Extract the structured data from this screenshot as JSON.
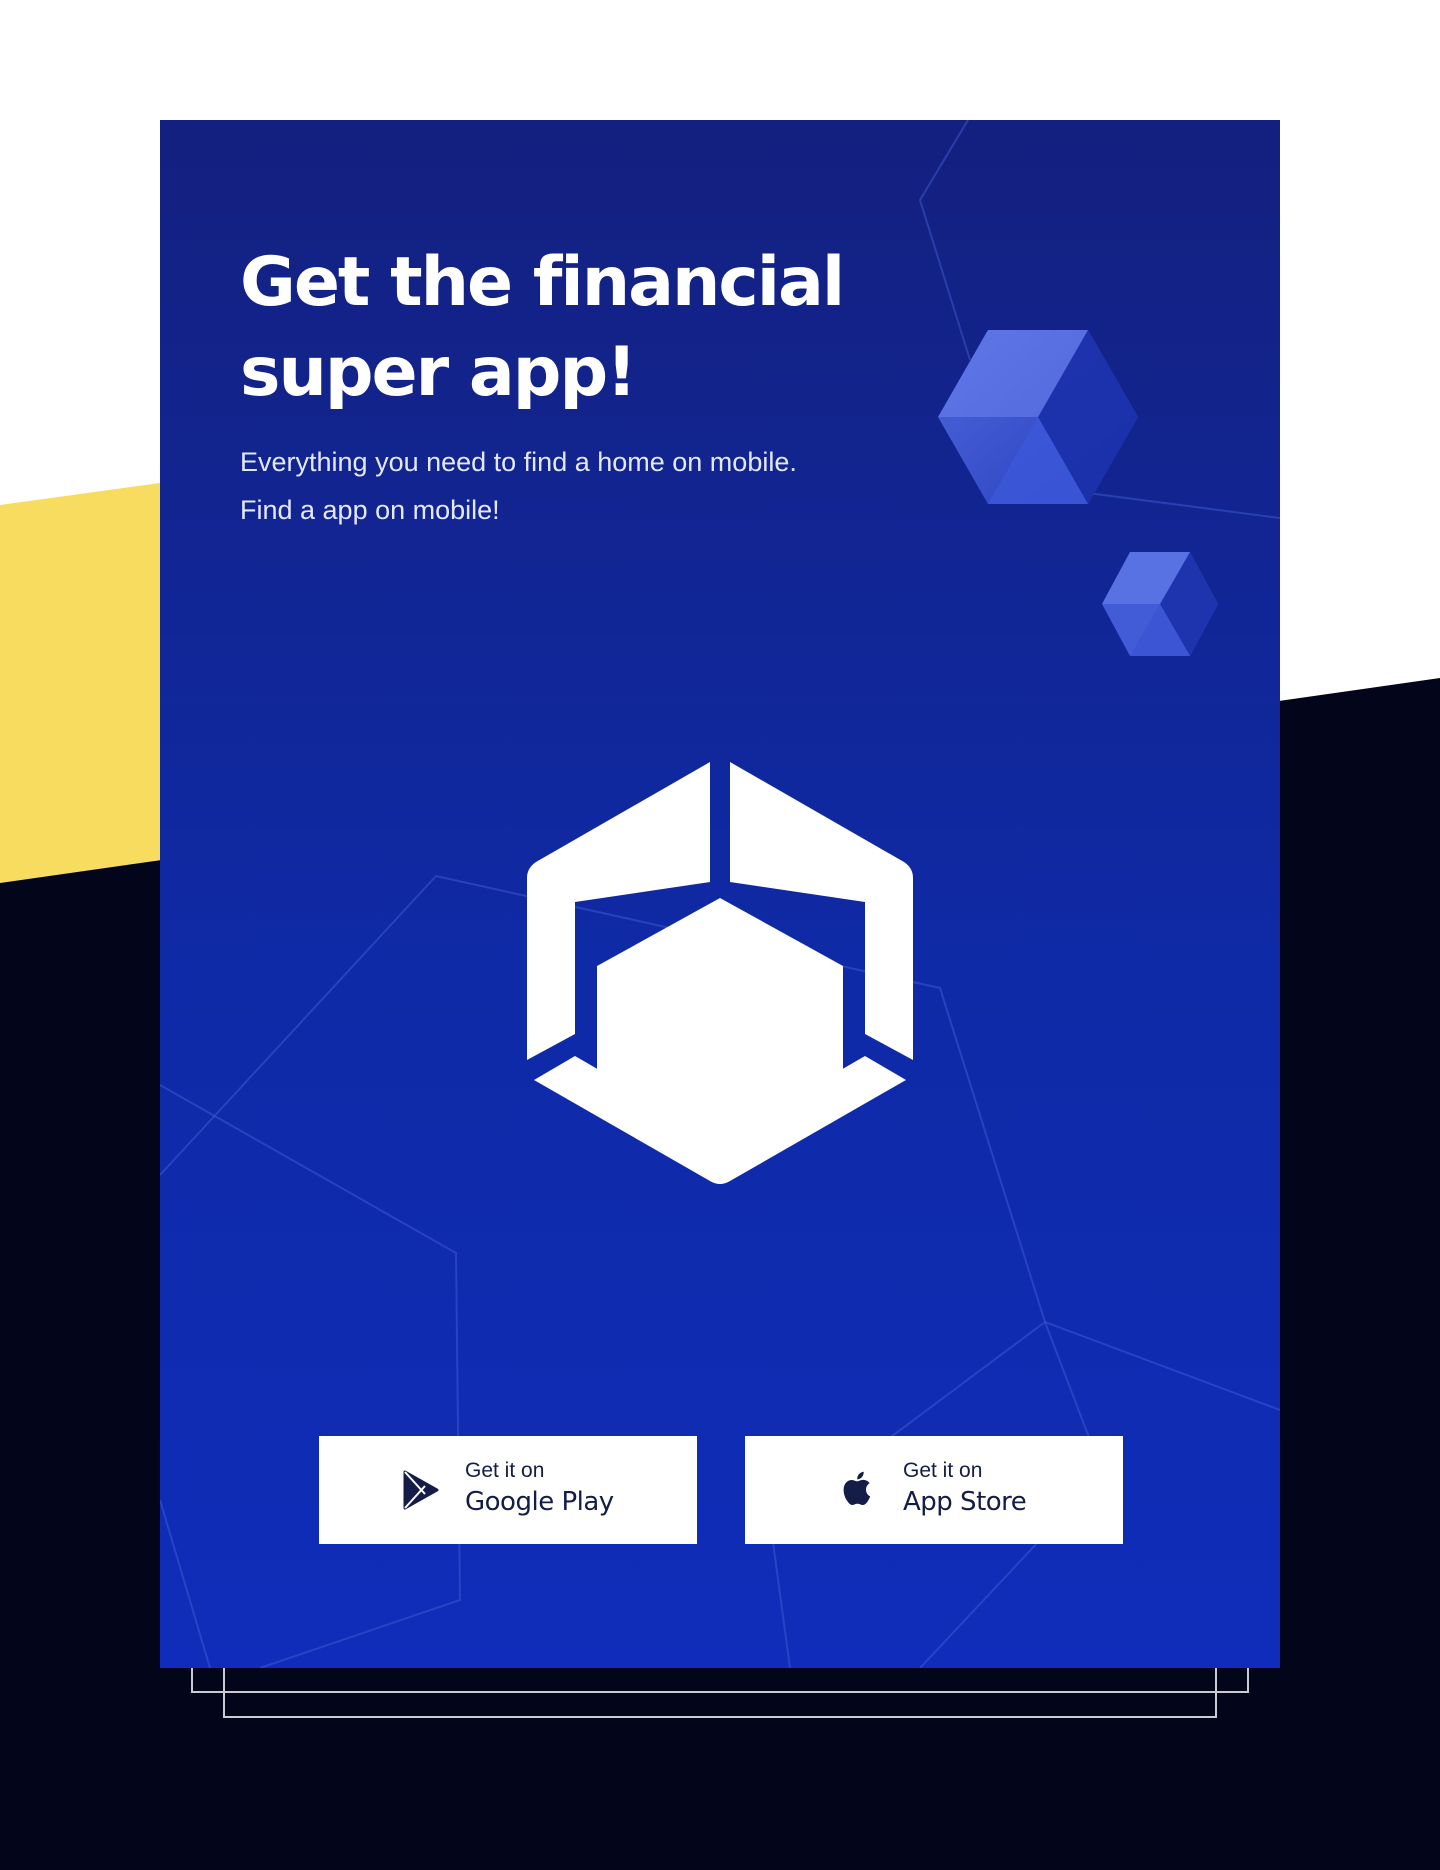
{
  "colors": {
    "card_top": "#14207f",
    "card_bottom": "#0f2dba",
    "accent_yellow": "#f7dc60",
    "dark_background": "#03061a",
    "text_on_card": "#ffffff",
    "button_text": "#141c48"
  },
  "hero": {
    "title": "Get the financial super app!",
    "subtitle": "Everything you need to find a home on mobile. Find a app on mobile!"
  },
  "logo": {
    "icon": "hexagon-logo-icon"
  },
  "downloads": {
    "google_play": {
      "prefix": "Get it on",
      "store": "Google Play",
      "icon": "google-play-icon"
    },
    "app_store": {
      "prefix": "Get it on",
      "store": "App Store",
      "icon": "apple-icon"
    }
  }
}
